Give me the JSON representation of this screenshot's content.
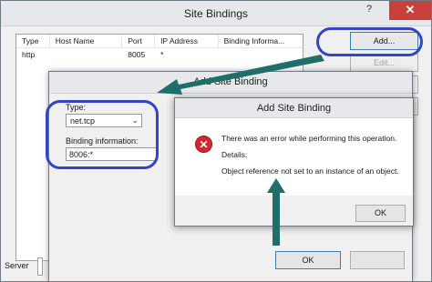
{
  "site_bindings": {
    "title": "Site Bindings",
    "help": "?",
    "close": "✕",
    "columns": [
      "Type",
      "Host Name",
      "Port",
      "IP Address",
      "Binding Informa..."
    ],
    "rows": [
      {
        "type": "http",
        "host": "",
        "port": "8005",
        "ip": "*",
        "binding": ""
      }
    ],
    "buttons": {
      "add": "Add...",
      "edit": "Edit..."
    },
    "footer_text": "Server"
  },
  "add_site_binding": {
    "title": "Add Site Binding",
    "type_label": "Type:",
    "type_value": "net.tcp",
    "binding_label": "Binding information:",
    "binding_value": "8006:*",
    "ok": "OK"
  },
  "error_dialog": {
    "title": "Add Site Binding",
    "line1": "There was an error while performing this operation.",
    "line2": "Details:",
    "line3": "Object reference not set to an instance of an object.",
    "ok": "OK",
    "icon": "error-icon"
  },
  "colors": {
    "highlight": "#3344c8",
    "arrow": "#1f6e6a",
    "error": "#d6262c",
    "close": "#c7403a"
  }
}
